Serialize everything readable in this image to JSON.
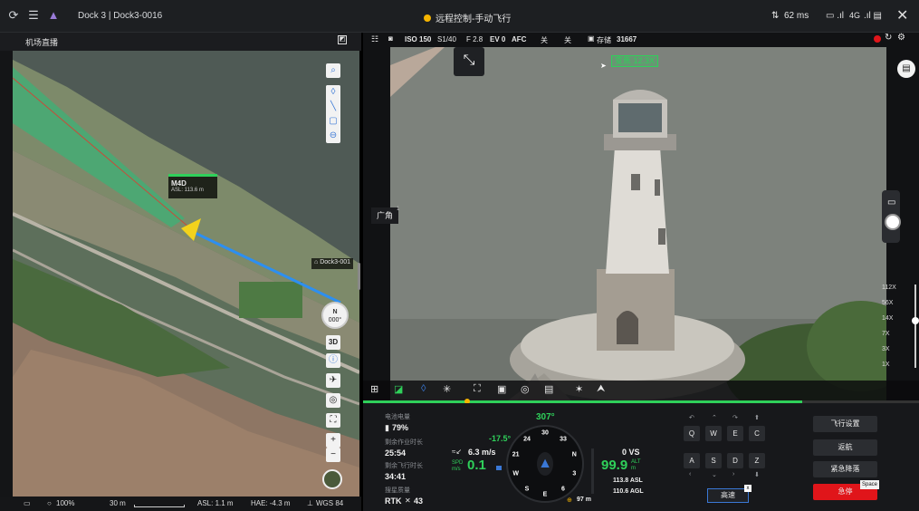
{
  "topbar": {
    "dock_title": "Dock 3 | Dock3-0016",
    "mode": "远程控制-手动飞行",
    "latency": "62 ms",
    "signal": "4G",
    "close_glyph": "✕"
  },
  "map": {
    "title": "机场直播",
    "drone_label": "M4D",
    "drone_asl": "ASL: 113.6 m",
    "dock_label": "Dock3-001",
    "compass_n": "N",
    "compass_deg": "000°",
    "view_3d": "3D",
    "footer": {
      "zoom": "100%",
      "scale": "30 m",
      "asl": "ASL: 1.1 m",
      "hae": "HAE: -4.3 m",
      "datum": "WGS 84"
    }
  },
  "camera": {
    "iso": "ISO 150",
    "shutter": "S1/40",
    "aperture": "F 2.8",
    "ev": "EV 0",
    "focus": "AFC",
    "opt1": "关",
    "opt2": "关",
    "storage": "存储",
    "storage_count": "31667",
    "zoom_tag": "变焦 12.3X",
    "wide_label": "广角",
    "zoom_levels": [
      "112X",
      "56X",
      "14X",
      "7X",
      "3X",
      "1X"
    ]
  },
  "console": {
    "battery_label": "电池电量",
    "battery": "79%",
    "remaining_work_label": "剩余作业时长",
    "remaining_work": "25:54",
    "remaining_flight_label": "剩余飞行时长",
    "remaining_flight": "34:41",
    "positioning_label": "搜星质量",
    "positioning": "RTK",
    "satellites": "43",
    "wind": "6.3 m/s",
    "spd_label": "SPD",
    "spd_unit": "m/s",
    "spd": "0.1",
    "pitch": "-17.5°",
    "heading": "307°",
    "compass_labels": [
      "30",
      "33",
      "N",
      "3",
      "6",
      "E",
      "S",
      "W",
      "21",
      "24"
    ],
    "vs": "0 VS",
    "alt": "99.9",
    "alt_label": "ALT",
    "alt_unit": "m",
    "asl": "113.8 ASL",
    "agl": "110.6 AGL",
    "home_dist": "97 m",
    "keys_row1": [
      "Q",
      "W",
      "E",
      "C"
    ],
    "keys_row2": [
      "A",
      "S",
      "D",
      "Z"
    ],
    "speed_mode": "高速",
    "btn_flight_settings": "飞行设置",
    "btn_return": "返航",
    "btn_emergency_land": "紧急降落",
    "btn_stop": "急停",
    "space_hint": "Space"
  },
  "colors": {
    "accent_green": "#2fd05a",
    "stop_red": "#e0151a",
    "drone_yellow": "#f3d21c",
    "route_blue": "#2d8ff0"
  }
}
